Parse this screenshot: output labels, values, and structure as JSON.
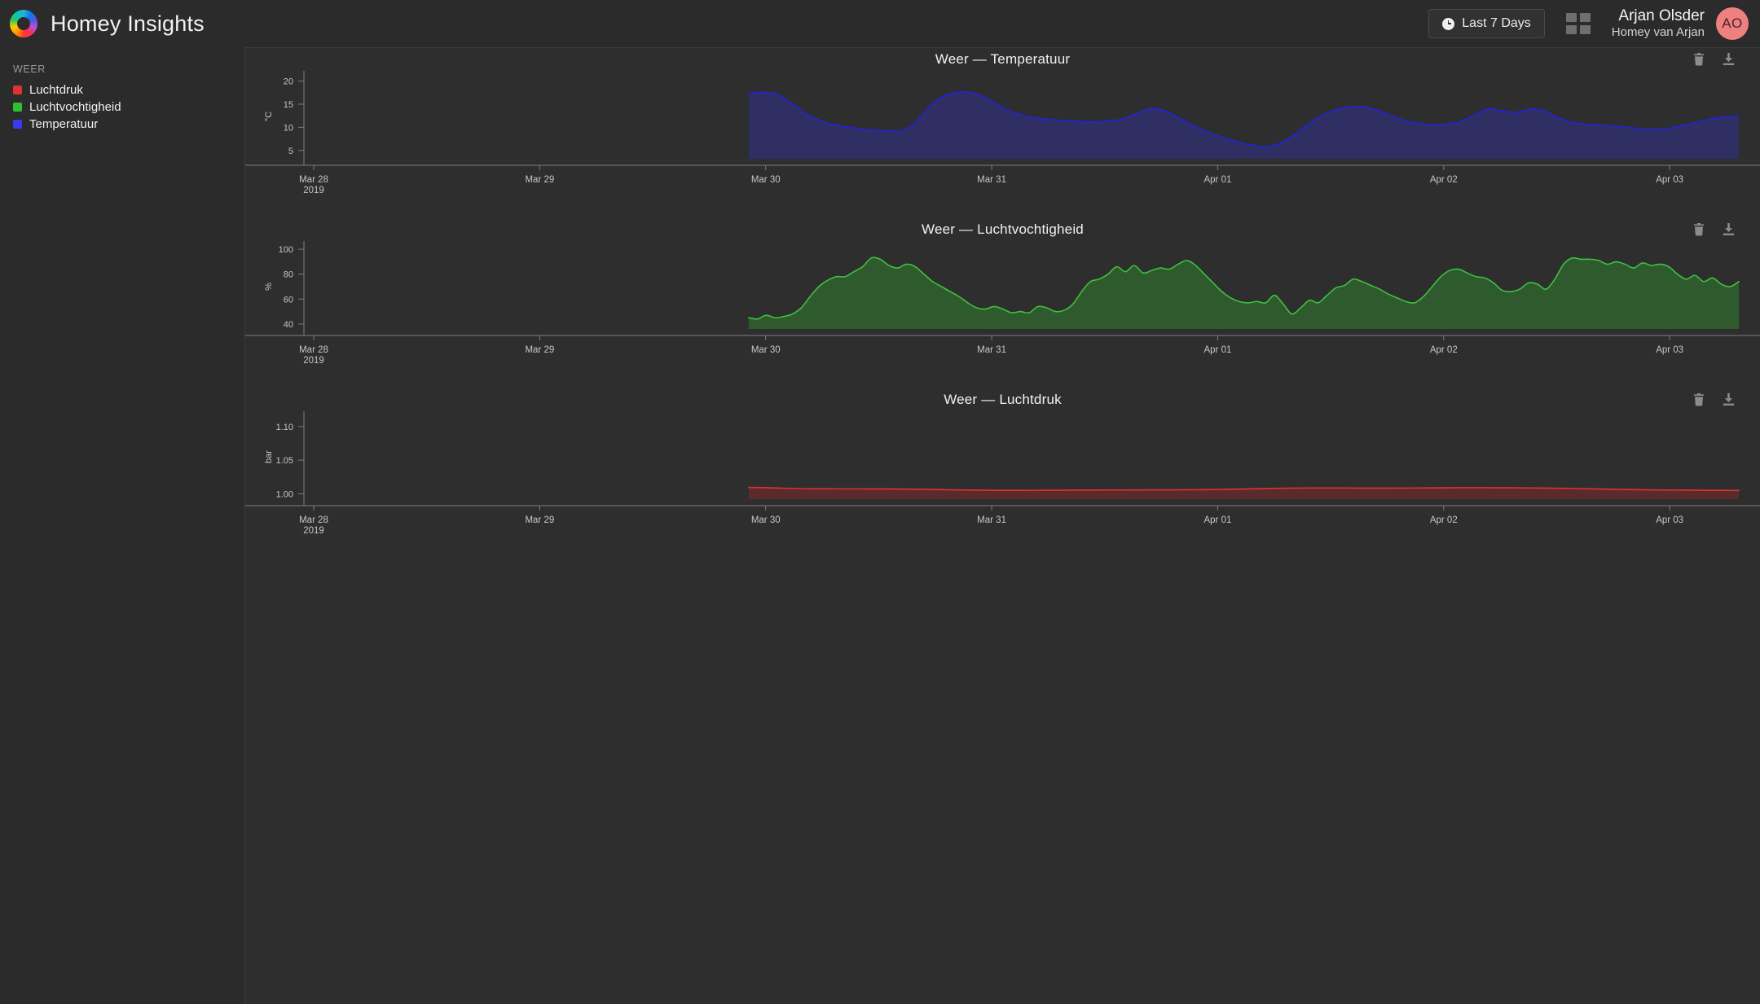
{
  "app": {
    "title": "Homey Insights",
    "logo_icon": "homey-ring-logo",
    "background": "#2b2b2b",
    "panel_background": "#2e2e2e"
  },
  "header": {
    "range_button": {
      "label": "Last 7 Days",
      "icon": "clock-icon"
    },
    "grid_button": {
      "icon": "grid-view-icon"
    },
    "user": {
      "name": "Arjan Olsder",
      "home": "Homey van Arjan",
      "initials": "AO",
      "avatar_color": "#ef8080"
    }
  },
  "sidebar": {
    "group_title": "WEER",
    "items": [
      {
        "label": "Luchtdruk",
        "color": "#e03232"
      },
      {
        "label": "Luchtvochtigheid",
        "color": "#2fbf2f"
      },
      {
        "label": "Temperatuur",
        "color": "#3a3af0"
      }
    ]
  },
  "cards": [
    {
      "title": "Weer — Temperatuur",
      "delete_icon": "trash-icon",
      "download_icon": "download-icon"
    },
    {
      "title": "Weer — Luchtvochtigheid",
      "delete_icon": "trash-icon",
      "download_icon": "download-icon"
    },
    {
      "title": "Weer — Luchtdruk",
      "delete_icon": "trash-icon",
      "download_icon": "download-icon"
    }
  ],
  "chart_data": [
    {
      "type": "area",
      "title": "Weer — Temperatuur",
      "xlabel": "",
      "ylabel": "°C",
      "line_color": "#2222dd",
      "fill_color": "#2f2f63",
      "grid": false,
      "legend": "none",
      "yticks": [
        20,
        15,
        10,
        5
      ],
      "ylim": [
        3.2,
        21.5
      ],
      "xticks": [
        "Mar 28\n2019",
        "Mar 29",
        "Mar 30",
        "Mar 31",
        "Apr 01",
        "Apr 02",
        "Apr 03"
      ],
      "x_start_fraction": 0.31,
      "values": [
        17.3,
        17.6,
        17.2,
        15.4,
        13.1,
        11.6,
        10.6,
        10.1,
        9.7,
        9.4,
        9.3,
        9.2,
        11.2,
        14.6,
        16.8,
        17.6,
        17.5,
        16.4,
        14.6,
        13.2,
        12.4,
        11.9,
        11.6,
        11.4,
        11.2,
        11.2,
        11.4,
        12.0,
        13.2,
        14.1,
        13.4,
        11.8,
        10.2,
        8.9,
        7.8,
        6.9,
        6.2,
        5.8,
        6.4,
        8.1,
        10.4,
        12.4,
        13.7,
        14.4,
        14.5,
        13.8,
        12.6,
        11.5,
        10.9,
        10.6,
        10.7,
        11.2,
        12.6,
        13.9,
        13.6,
        13.2,
        13.9,
        13.6,
        12.1,
        11.1,
        10.7,
        10.5,
        10.3,
        10.0,
        9.7,
        9.6,
        9.8,
        10.4,
        11.1,
        11.8,
        12.2,
        12.4
      ]
    },
    {
      "type": "area",
      "title": "Weer — Luchtvochtigheid",
      "xlabel": "",
      "ylabel": "%",
      "line_color": "#3ec13e",
      "fill_color": "#2e5a2e",
      "grid": false,
      "legend": "none",
      "yticks": [
        100,
        80,
        60,
        40
      ],
      "ylim": [
        36,
        104
      ],
      "xticks": [
        "Mar 28\n2019",
        "Mar 29",
        "Mar 30",
        "Mar 31",
        "Apr 01",
        "Apr 02",
        "Apr 03"
      ],
      "x_start_fraction": 0.31,
      "values": [
        45,
        44,
        47,
        45,
        46,
        48,
        53,
        62,
        70,
        75,
        78,
        78,
        82,
        86,
        93,
        92,
        87,
        85,
        88,
        86,
        80,
        74,
        70,
        66,
        62,
        57,
        53,
        52,
        54,
        52,
        49,
        50,
        49,
        54,
        53,
        50,
        51,
        56,
        66,
        74,
        76,
        80,
        86,
        82,
        87,
        81,
        83,
        85,
        84,
        88,
        91,
        87,
        80,
        73,
        66,
        61,
        58,
        57,
        58,
        57,
        63,
        56,
        48,
        53,
        59,
        57,
        63,
        69,
        71,
        76,
        74,
        71,
        68,
        64,
        61,
        58,
        57,
        62,
        70,
        78,
        83,
        84,
        81,
        78,
        77,
        73,
        67,
        66,
        68,
        73,
        72,
        68,
        76,
        88,
        93,
        92,
        92,
        91,
        88,
        90,
        88,
        85,
        89,
        87,
        88,
        86,
        80,
        76,
        79,
        74,
        77,
        72,
        70,
        74
      ]
    },
    {
      "type": "area",
      "title": "Weer — Luchtdruk",
      "xlabel": "",
      "ylabel": "bar",
      "line_color": "#e03232",
      "fill_color": "#5b2a2a",
      "grid": false,
      "legend": "none",
      "yticks": [
        "1.10",
        "1.05",
        "1.00"
      ],
      "ylim": [
        0.992,
        1.118
      ],
      "xticks": [
        "Mar 28\n2019",
        "Mar 29",
        "Mar 30",
        "Mar 31",
        "Apr 01",
        "Apr 02",
        "Apr 03"
      ],
      "x_start_fraction": 0.31,
      "values": [
        1.0095,
        1.009,
        1.0082,
        1.0076,
        1.0074,
        1.0073,
        1.0073,
        1.0072,
        1.0071,
        1.0068,
        1.0064,
        1.0059,
        1.0055,
        1.0052,
        1.0051,
        1.0051,
        1.0052,
        1.0053,
        1.0054,
        1.0055,
        1.0056,
        1.0057,
        1.0058,
        1.0059,
        1.006,
        1.0062,
        1.0066,
        1.0071,
        1.0077,
        1.0082,
        1.0085,
        1.0086,
        1.0086,
        1.0085,
        1.0084,
        1.0084,
        1.0085,
        1.0087,
        1.0089,
        1.009,
        1.009,
        1.0089,
        1.0088,
        1.0086,
        1.0083,
        1.0079,
        1.0074,
        1.0068,
        1.0063,
        1.0059,
        1.0056,
        1.0054,
        1.0052,
        1.0051,
        1.005
      ]
    }
  ]
}
